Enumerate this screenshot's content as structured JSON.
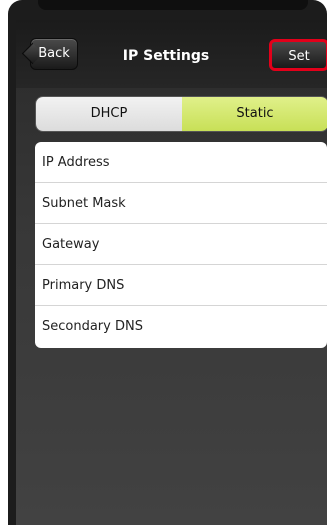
{
  "nav": {
    "back_label": "Back",
    "title": "IP Settings",
    "set_label": "Set"
  },
  "segment": {
    "options": [
      "DHCP",
      "Static"
    ],
    "selected": "Static"
  },
  "fields": [
    {
      "label": "IP Address"
    },
    {
      "label": "Subnet Mask"
    },
    {
      "label": "Gateway"
    },
    {
      "label": "Primary DNS"
    },
    {
      "label": "Secondary DNS"
    }
  ],
  "colors": {
    "selected_segment": "#c8e057",
    "highlight": "#e3001a"
  }
}
